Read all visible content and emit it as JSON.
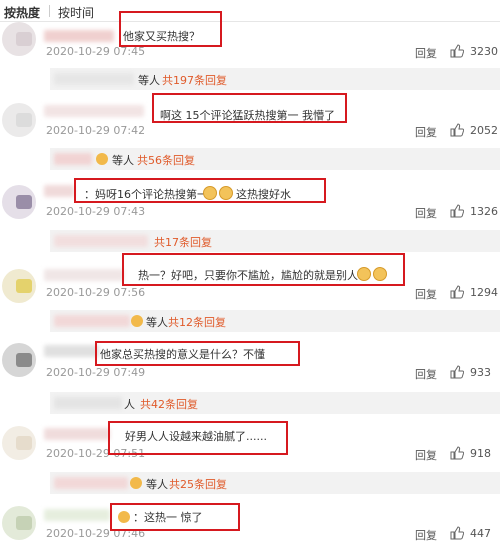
{
  "sort": {
    "hot": "按热度",
    "time": "按时间"
  },
  "reply_label": "回复",
  "comments": [
    {
      "text": "他家又买热搜？",
      "time": "2020-10-29 07:45",
      "likes": "3230"
    },
    {
      "text": "啊这 15个评论猛跃热搜第一 我懵了",
      "time": "2020-10-29 07:42",
      "likes": "2052"
    },
    {
      "text": "：妈呀16个评论热搜第一",
      "text2": "这热搜好水",
      "time": "2020-10-29 07:43",
      "likes": "1326"
    },
    {
      "text": "热一？好吧，只要你不尴尬，尴尬的就是别人",
      "time": "2020-10-29 07:56",
      "likes": "1294"
    },
    {
      "text": "他家总买热搜的意义是什么？不懂",
      "time": "2020-10-29 07:49",
      "likes": "933"
    },
    {
      "text": "好男人人设越来越油腻了......",
      "time": "2020-10-29 07:51",
      "likes": "918"
    },
    {
      "text": "：这热一 惊了",
      "time": "2020-10-29 07:46",
      "likes": "447"
    }
  ],
  "subreplies": [
    {
      "people": "等人",
      "more": "共197条回复"
    },
    {
      "people": "等人",
      "more": "共56条回复"
    },
    {
      "people": "",
      "more": "共17条回复"
    },
    {
      "people": "等人",
      "more": "共12条回复"
    },
    {
      "people": "人",
      "more": "共42条回复"
    },
    {
      "people": "等人",
      "more": "共25条回复"
    }
  ],
  "colors": {
    "highlight": "#d6191f",
    "accent": "#e05a2a"
  }
}
